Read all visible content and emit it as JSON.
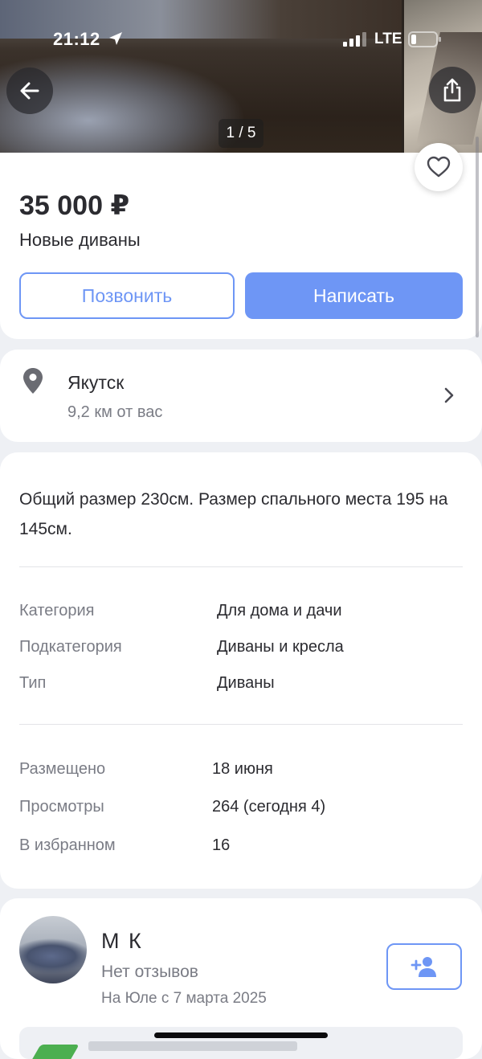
{
  "status_bar": {
    "time": "21:12",
    "network": "LTE"
  },
  "gallery": {
    "counter": "1 / 5"
  },
  "listing": {
    "price": "35 000 ₽",
    "title": "Новые диваны",
    "call_label": "Позвонить",
    "write_label": "Написать"
  },
  "location": {
    "city": "Якутск",
    "distance": "9,2 км от вас"
  },
  "description": "Общий размер 230см. Размер спального места 195 на 145см.",
  "properties": [
    {
      "label": "Категория",
      "value": "Для дома и дачи"
    },
    {
      "label": "Подкатегория",
      "value": "Диваны и кресла"
    },
    {
      "label": "Тип",
      "value": "Диваны"
    }
  ],
  "stats": [
    {
      "label": "Размещено",
      "value": "18 июня"
    },
    {
      "label": "Просмотры",
      "value": "264 (сегодня 4)"
    },
    {
      "label": "В избранном",
      "value": "16"
    }
  ],
  "seller": {
    "name": "М К",
    "reviews": "Нет отзывов",
    "since": "На Юле с 7 марта 2025"
  },
  "icons": {
    "back": "arrow-left-icon",
    "share": "share-icon",
    "favorite": "heart-icon",
    "location": "map-pin-icon",
    "chevron": "chevron-right-icon",
    "follow": "add-user-icon"
  },
  "colors": {
    "accent": "#6e96f5",
    "background": "#eef0f4"
  }
}
